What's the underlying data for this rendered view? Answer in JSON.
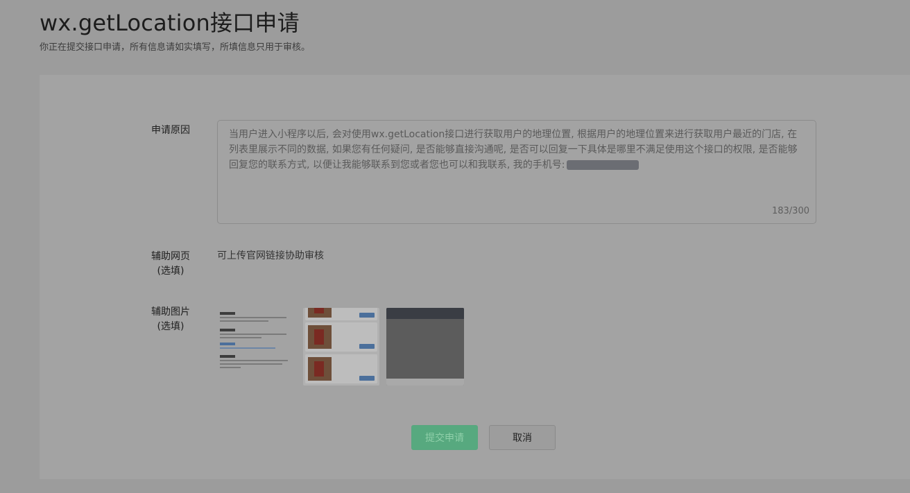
{
  "header": {
    "title": "wx.getLocation接口申请",
    "subtitle": "你正在提交接口申请，所有信息请如实填写，所填信息只用于审核。"
  },
  "form": {
    "reason": {
      "label": "申请原因",
      "text": "当用户进入小程序以后, 会对使用wx.getLocation接口进行获取用户的地理位置, 根据用户的地理位置来进行获取用户最近的门店, 在列表里展示不同的数据, 如果您有任何疑问, 是否能够直接沟通呢, 是否可以回复一下具体是哪里不满足使用这个接口的权限, 是否能够回复您的联系方式, 以便让我能够联系到您或者您也可以和我联系, 我的手机号:",
      "counter": "183/300"
    },
    "webpage": {
      "label": "辅助网页",
      "optional": "(选填)",
      "hint": "可上传官网链接协助审核"
    },
    "images": {
      "label": "辅助图片",
      "optional": "(选填)",
      "thumbnails": [
        "screenshot-text-page",
        "screenshot-product-list",
        "screenshot-map-page"
      ]
    }
  },
  "actions": {
    "submit_label": "提交申请",
    "cancel_label": "取消"
  },
  "colors": {
    "overlay_bg": "#9c9c9c",
    "submit_green": "#57a97f"
  }
}
